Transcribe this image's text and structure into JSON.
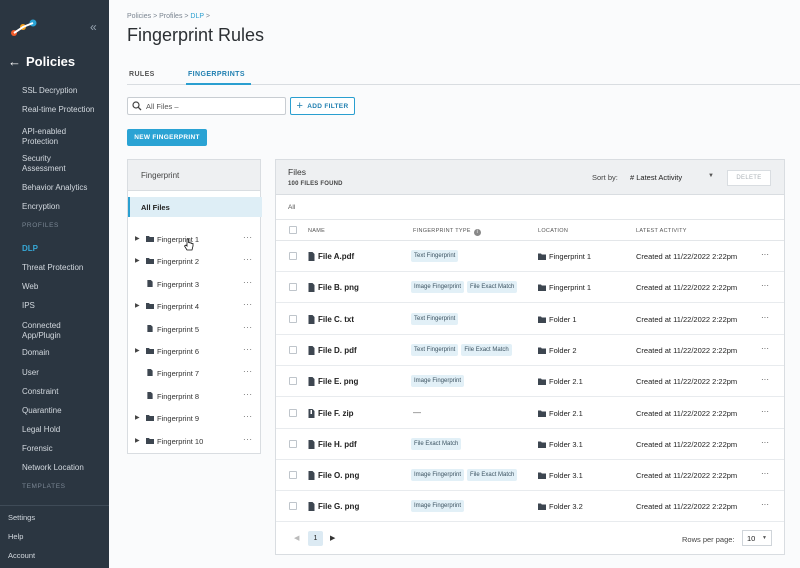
{
  "sidebar": {
    "title": "Policies",
    "items": [
      {
        "label": "SSL Decryption"
      },
      {
        "label": "Real-time Protection"
      },
      {
        "label": "API-enabled\nProtection"
      },
      {
        "label": "Security\nAssessment"
      },
      {
        "label": "Behavior Analytics"
      },
      {
        "label": "Encryption"
      }
    ],
    "section_profiles": "PROFILES",
    "profile_items": [
      {
        "label": "DLP",
        "active": true
      },
      {
        "label": "Threat Protection"
      },
      {
        "label": "Web"
      },
      {
        "label": "IPS"
      },
      {
        "label": "Connected\nApp/Plugin"
      },
      {
        "label": "Domain"
      },
      {
        "label": "User"
      },
      {
        "label": "Constraint"
      },
      {
        "label": "Quarantine"
      },
      {
        "label": "Legal Hold"
      },
      {
        "label": "Forensic"
      },
      {
        "label": "Network Location"
      }
    ],
    "section_templates": "TEMPLATES",
    "bottom_items": [
      {
        "label": "Settings"
      },
      {
        "label": "Help"
      },
      {
        "label": "Account"
      }
    ],
    "accent_color": "#36a8d6"
  },
  "breadcrumb": {
    "part1": "Policies > Profiles > ",
    "current": "DLP",
    "tail": " >"
  },
  "page_title": "Fingerprint Rules",
  "tabs": [
    {
      "label": "RULES"
    },
    {
      "label": "FINGERPRINTS",
      "active": true
    }
  ],
  "search": {
    "value": "All Files –"
  },
  "add_filter_label": "ADD FILTER",
  "new_fingerprint_label": "NEW FINGERPRINT",
  "fingerprint_panel": {
    "header": "Fingerprint",
    "all_label": "All Files",
    "items": [
      {
        "label": "Fingerprint 1",
        "type": "folder",
        "expandable": true
      },
      {
        "label": "Fingerprint 2",
        "type": "folder",
        "expandable": true
      },
      {
        "label": "Fingerprint 3",
        "type": "file",
        "expandable": false
      },
      {
        "label": "Fingerprint 4",
        "type": "folder",
        "expandable": true
      },
      {
        "label": "Fingerprint 5",
        "type": "file",
        "expandable": false
      },
      {
        "label": "Fingerprint 6",
        "type": "folder",
        "expandable": true
      },
      {
        "label": "Fingerprint 7",
        "type": "file",
        "expandable": false
      },
      {
        "label": "Fingerprint 8",
        "type": "file",
        "expandable": false
      },
      {
        "label": "Fingerprint 9",
        "type": "folder",
        "expandable": true
      },
      {
        "label": "Fingerprint 10",
        "type": "folder",
        "expandable": true
      }
    ]
  },
  "files_panel": {
    "title": "Files",
    "count": "100 FILES FOUND",
    "sort_label": "Sort by:",
    "sort_value": "# Latest Activity",
    "delete_label": "DELETE",
    "all_label": "All",
    "columns": {
      "name": "NAME",
      "type": "FINGERPRINT TYPE",
      "location": "LOCATION",
      "activity": "LATEST ACTIVITY"
    },
    "rows": [
      {
        "name": "File A.pdf",
        "icon": "file",
        "tags": [
          "Text Fingerprint"
        ],
        "location": "Fingerprint 1",
        "activity": "Created at 11/22/2022 2:22pm"
      },
      {
        "name": "File B. png",
        "icon": "file",
        "tags": [
          "Image Fingerprint",
          "File Exact Match"
        ],
        "location": "Fingerprint 1",
        "activity": "Created at 11/22/2022 2:22pm"
      },
      {
        "name": "File C. txt",
        "icon": "file",
        "tags": [
          "Text Fingerprint"
        ],
        "location": "Folder 1",
        "activity": "Created at 11/22/2022 2:22pm"
      },
      {
        "name": "File D. pdf",
        "icon": "file",
        "tags": [
          "Text Fingerprint",
          "File Exact Match"
        ],
        "location": "Folder 2",
        "activity": "Created at 11/22/2022 2:22pm"
      },
      {
        "name": "File E. png",
        "icon": "file",
        "tags": [
          "Image Fingerprint"
        ],
        "location": "Folder 2.1",
        "activity": "Created at 11/22/2022 2:22pm"
      },
      {
        "name": "File F. zip",
        "icon": "zip",
        "tags": [],
        "dash": "—",
        "location": "Folder 2.1",
        "activity": "Created at 11/22/2022 2:22pm"
      },
      {
        "name": "File H. pdf",
        "icon": "file",
        "tags": [
          "File Exact Match"
        ],
        "location": "Folder 3.1",
        "activity": "Created at 11/22/2022 2:22pm"
      },
      {
        "name": "File O. png",
        "icon": "file",
        "tags": [
          "Image Fingerprint",
          "File Exact Match"
        ],
        "location": "Folder 3.1",
        "activity": "Created at 11/22/2022 2:22pm"
      },
      {
        "name": "File G. png",
        "icon": "file",
        "tags": [
          "Image Fingerprint"
        ],
        "location": "Folder 3.2",
        "activity": "Created at 11/22/2022 2:22pm"
      }
    ],
    "pagination": {
      "current_page": "1",
      "rows_per_page_label": "Rows per page:",
      "rows_per_page_value": "10"
    }
  }
}
